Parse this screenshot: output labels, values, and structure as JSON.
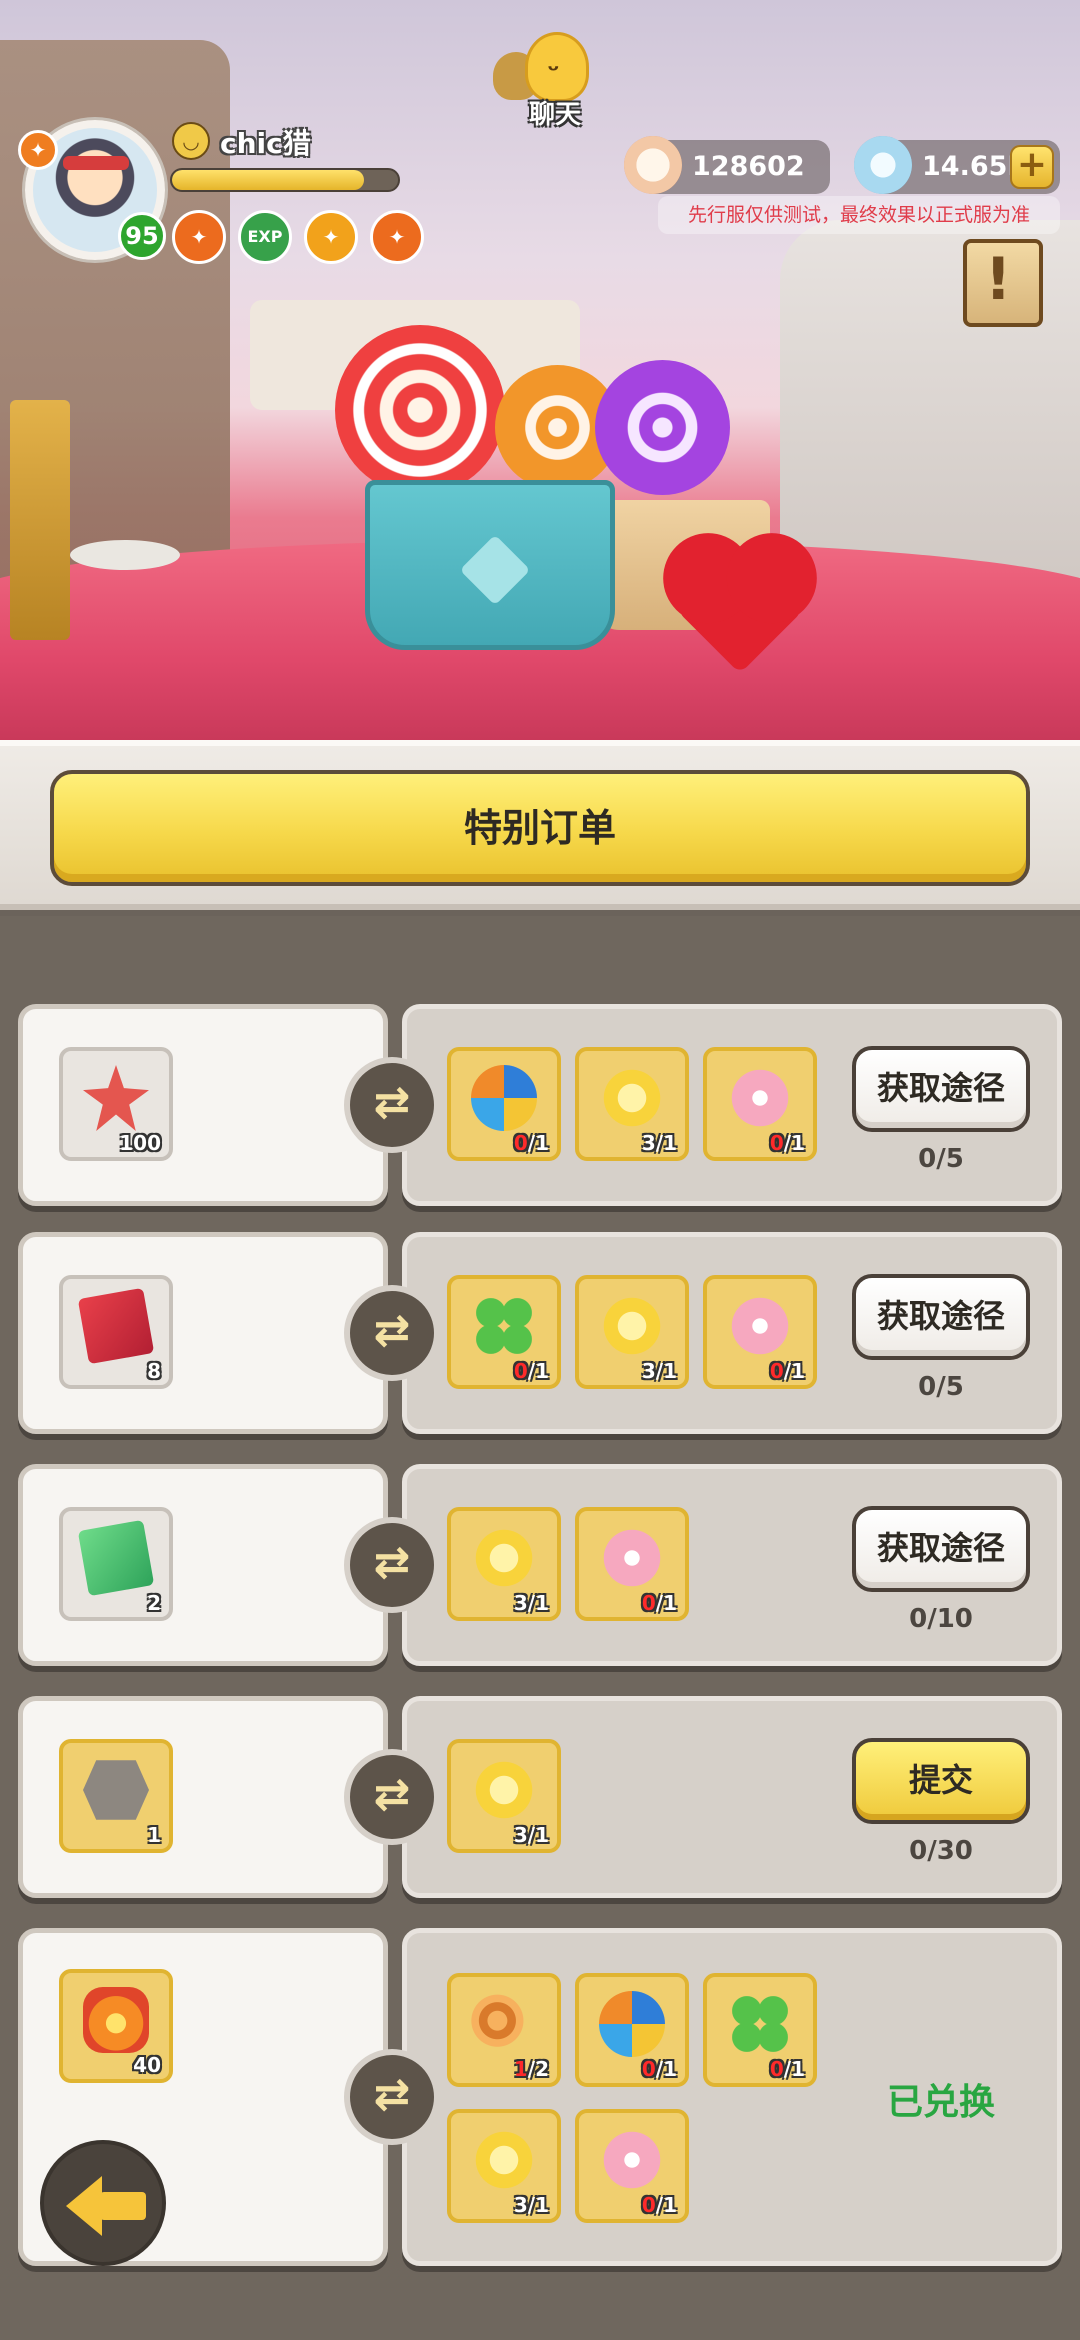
{
  "chat": {
    "label": "聊天"
  },
  "player": {
    "name": "chic猎",
    "level": "95",
    "xp_fraction": 0.85,
    "buffs": [
      {
        "icon": "paw-buff-icon",
        "color": "#ec6b1e"
      },
      {
        "icon": "exp-buff-icon",
        "text": "EXP",
        "color": "#37a14a"
      },
      {
        "icon": "fire-buff-icon",
        "color": "#f2a21b"
      },
      {
        "icon": "mask-buff-icon",
        "color": "#ec6b1e"
      }
    ]
  },
  "currency": {
    "shells": "128602",
    "gems": "14.65M",
    "plus": "+"
  },
  "notice": "先行服仅供测试，最终效果以正式服为准",
  "panel_title": "特别订单",
  "orders": [
    {
      "reward": {
        "icon": "starfish-icon",
        "count": "100"
      },
      "requirements": [
        {
          "icon": "pinwheel-icon",
          "have": "0",
          "need": "1"
        },
        {
          "icon": "sun-icon",
          "have": "3",
          "need": "1"
        },
        {
          "icon": "flower-icon",
          "have": "0",
          "need": "1"
        }
      ],
      "action": "获取途径",
      "progress": "0/5"
    },
    {
      "reward": {
        "icon": "red-ticket-icon",
        "count": "8"
      },
      "requirements": [
        {
          "icon": "clover-icon",
          "have": "0",
          "need": "1"
        },
        {
          "icon": "sun-icon",
          "have": "3",
          "need": "1"
        },
        {
          "icon": "flower-icon",
          "have": "0",
          "need": "1"
        }
      ],
      "action": "获取途径",
      "progress": "0/5"
    },
    {
      "reward": {
        "icon": "green-ticket-icon",
        "count": "2"
      },
      "requirements": [
        {
          "icon": "sun-icon",
          "have": "3",
          "need": "1"
        },
        {
          "icon": "flower-icon",
          "have": "0",
          "need": "1"
        }
      ],
      "action": "获取途径",
      "progress": "0/10"
    },
    {
      "reward": {
        "icon": "fossil-icon",
        "count": "1"
      },
      "requirements": [
        {
          "icon": "sun-icon",
          "have": "3",
          "need": "1"
        }
      ],
      "action": "提交",
      "progress": "0/30"
    },
    {
      "reward": {
        "icon": "fire-crystal-icon",
        "count": "40"
      },
      "requirements": [
        {
          "icon": "snail-icon",
          "have": "1",
          "need": "2"
        },
        {
          "icon": "pinwheel-icon",
          "have": "0",
          "need": "1"
        },
        {
          "icon": "clover-icon",
          "have": "0",
          "need": "1"
        },
        {
          "icon": "sun-icon",
          "have": "3",
          "need": "1"
        },
        {
          "icon": "flower-icon",
          "have": "0",
          "need": "1"
        }
      ],
      "status": "已兑换"
    }
  ]
}
